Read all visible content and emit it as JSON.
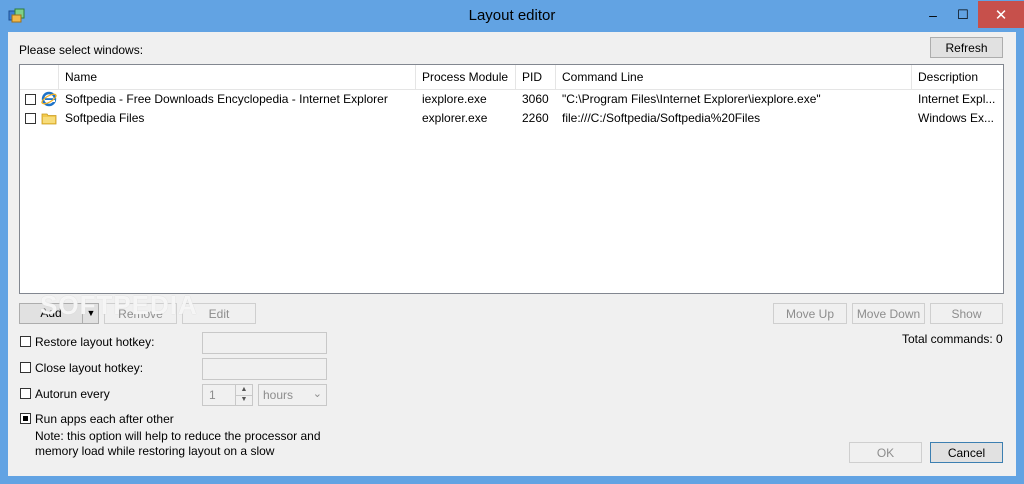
{
  "window": {
    "title": "Layout editor",
    "accent": "#62a3e3",
    "close_color": "#c7504b",
    "min_glyph": "–",
    "max_glyph": "☐",
    "close_glyph": "✕"
  },
  "header": {
    "prompt": "Please select windows:",
    "refresh_label": "Refresh"
  },
  "table": {
    "columns": [
      "Name",
      "Process Module",
      "PID",
      "Command Line",
      "Description"
    ],
    "rows": [
      {
        "icon": "internet-explorer-icon",
        "checked": false,
        "name": "Softpedia - Free Downloads Encyclopedia - Internet Explorer",
        "module": "iexplore.exe",
        "pid": "3060",
        "cmd": "\"C:\\Program Files\\Internet Explorer\\iexplore.exe\"",
        "desc": "Internet Expl..."
      },
      {
        "icon": "folder-icon",
        "checked": false,
        "name": "Softpedia Files",
        "module": "explorer.exe",
        "pid": "2260",
        "cmd": "file:///C:/Softpedia/Softpedia%20Files",
        "desc": "Windows Ex..."
      }
    ]
  },
  "actions": {
    "add": "Add",
    "add_arrow": "▼",
    "remove": "Remove",
    "edit": "Edit",
    "move_up": "Move Up",
    "move_down": "Move Down",
    "show": "Show"
  },
  "total_commands": "Total commands: 0",
  "options": {
    "restore_hotkey": {
      "label": "Restore layout hotkey:",
      "checked": false,
      "value": ""
    },
    "close_hotkey": {
      "label": "Close layout hotkey:",
      "checked": false,
      "value": ""
    },
    "autorun": {
      "label": "Autorun every",
      "checked": false,
      "value": "1",
      "unit": "hours"
    },
    "run_apps": {
      "label": "Run apps each after other",
      "checked": true
    },
    "note_line1": "Note: this option will help to reduce the processor and",
    "note_line2": "memory load while restoring layout on a slow"
  },
  "footer": {
    "ok": "OK",
    "cancel": "Cancel"
  },
  "watermark": "SOFTPEDIA"
}
